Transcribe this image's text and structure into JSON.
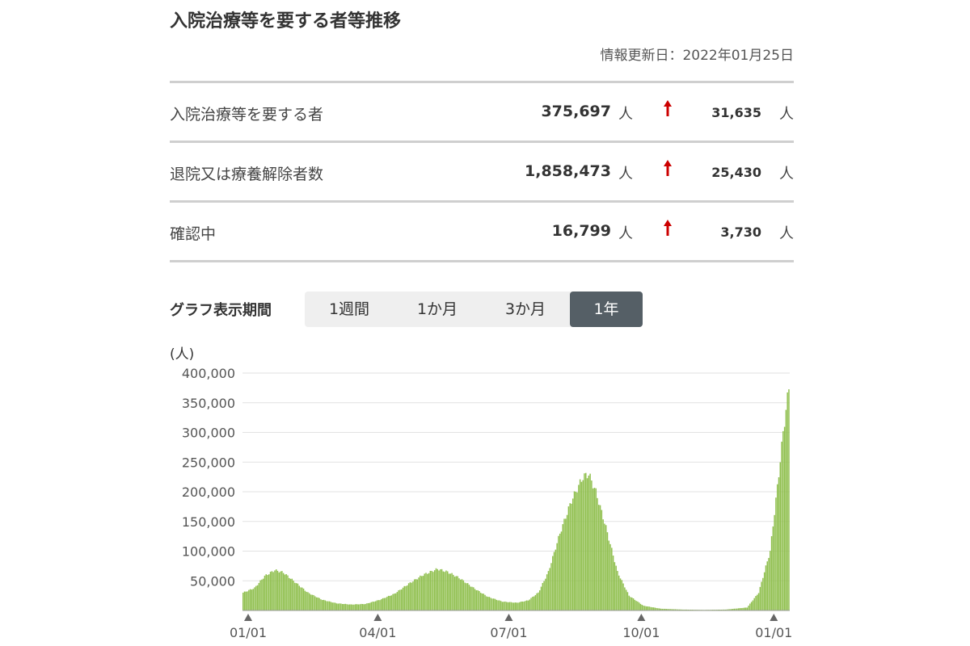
{
  "header": {
    "title": "入院治療等を要する者等推移",
    "updated": "情報更新日：2022年01月25日"
  },
  "stats": [
    {
      "label": "入院治療等を要する者",
      "value": "375,697",
      "unit": "人",
      "trend": "up",
      "delta": "31,635",
      "delta_unit": "人"
    },
    {
      "label": "退院又は療養解除者数",
      "value": "1,858,473",
      "unit": "人",
      "trend": "up",
      "delta": "25,430",
      "delta_unit": "人"
    },
    {
      "label": "確認中",
      "value": "16,799",
      "unit": "人",
      "trend": "up",
      "delta": "3,730",
      "delta_unit": "人"
    }
  ],
  "period": {
    "label": "グラフ表示期間",
    "options": [
      "1週間",
      "1か月",
      "3か月",
      "1年"
    ],
    "selected": "1年"
  },
  "colors": {
    "bar": "#8fbf4d",
    "bar_edge": "#6d9a30",
    "arrow": "#cc0000",
    "active_tab": "#555f66"
  },
  "chart_data": {
    "type": "bar",
    "unit_label": "(人)",
    "ylim": [
      0,
      400000
    ],
    "yticks": [
      "400,000",
      "350,000",
      "300,000",
      "250,000",
      "200,000",
      "150,000",
      "100,000",
      "50,000"
    ],
    "xticks": [
      "01/01",
      "04/01",
      "07/01",
      "10/01",
      "01/01"
    ],
    "xtick_day_index": [
      0,
      90,
      181,
      273,
      365
    ],
    "grid": true,
    "x_start": "01/01",
    "keyframes": [
      [
        0,
        30000
      ],
      [
        8,
        38000
      ],
      [
        15,
        58000
      ],
      [
        22,
        68000
      ],
      [
        28,
        64000
      ],
      [
        35,
        50000
      ],
      [
        45,
        30000
      ],
      [
        55,
        18000
      ],
      [
        65,
        12000
      ],
      [
        75,
        10000
      ],
      [
        85,
        11000
      ],
      [
        95,
        18000
      ],
      [
        105,
        28000
      ],
      [
        115,
        45000
      ],
      [
        125,
        60000
      ],
      [
        135,
        70000
      ],
      [
        142,
        65000
      ],
      [
        150,
        55000
      ],
      [
        160,
        38000
      ],
      [
        170,
        23000
      ],
      [
        180,
        15000
      ],
      [
        190,
        13000
      ],
      [
        198,
        17000
      ],
      [
        205,
        30000
      ],
      [
        212,
        65000
      ],
      [
        220,
        130000
      ],
      [
        228,
        185000
      ],
      [
        236,
        225000
      ],
      [
        240,
        230000
      ],
      [
        245,
        200000
      ],
      [
        252,
        140000
      ],
      [
        260,
        65000
      ],
      [
        268,
        25000
      ],
      [
        278,
        8000
      ],
      [
        290,
        3000
      ],
      [
        305,
        1500
      ],
      [
        320,
        1000
      ],
      [
        335,
        1500
      ],
      [
        350,
        5000
      ],
      [
        358,
        30000
      ],
      [
        366,
        100000
      ],
      [
        372,
        230000
      ],
      [
        375,
        300000
      ],
      [
        379,
        375697
      ]
    ],
    "days": 380
  }
}
